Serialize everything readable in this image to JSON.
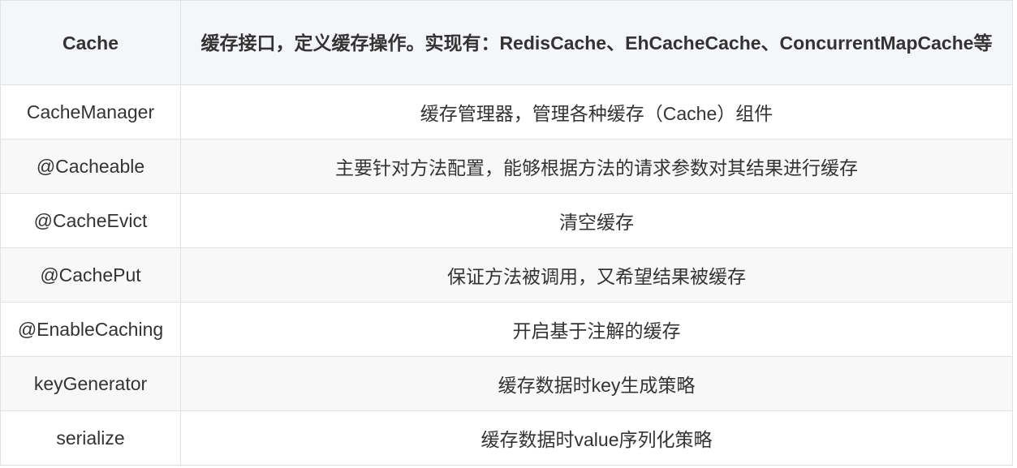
{
  "table": {
    "header": {
      "col1": "Cache",
      "col2": "缓存接口，定义缓存操作。实现有：RedisCache、EhCacheCache、ConcurrentMapCache等"
    },
    "rows": [
      {
        "name": "CacheManager",
        "desc": "缓存管理器，管理各种缓存（Cache）组件"
      },
      {
        "name": "@Cacheable",
        "desc": "主要针对方法配置，能够根据方法的请求参数对其结果进行缓存"
      },
      {
        "name": "@CacheEvict",
        "desc": "清空缓存"
      },
      {
        "name": "@CachePut",
        "desc": "保证方法被调用，又希望结果被缓存"
      },
      {
        "name": "@EnableCaching",
        "desc": "开启基于注解的缓存"
      },
      {
        "name": "keyGenerator",
        "desc": "缓存数据时key生成策略"
      },
      {
        "name": "serialize",
        "desc": "缓存数据时value序列化策略"
      }
    ]
  }
}
